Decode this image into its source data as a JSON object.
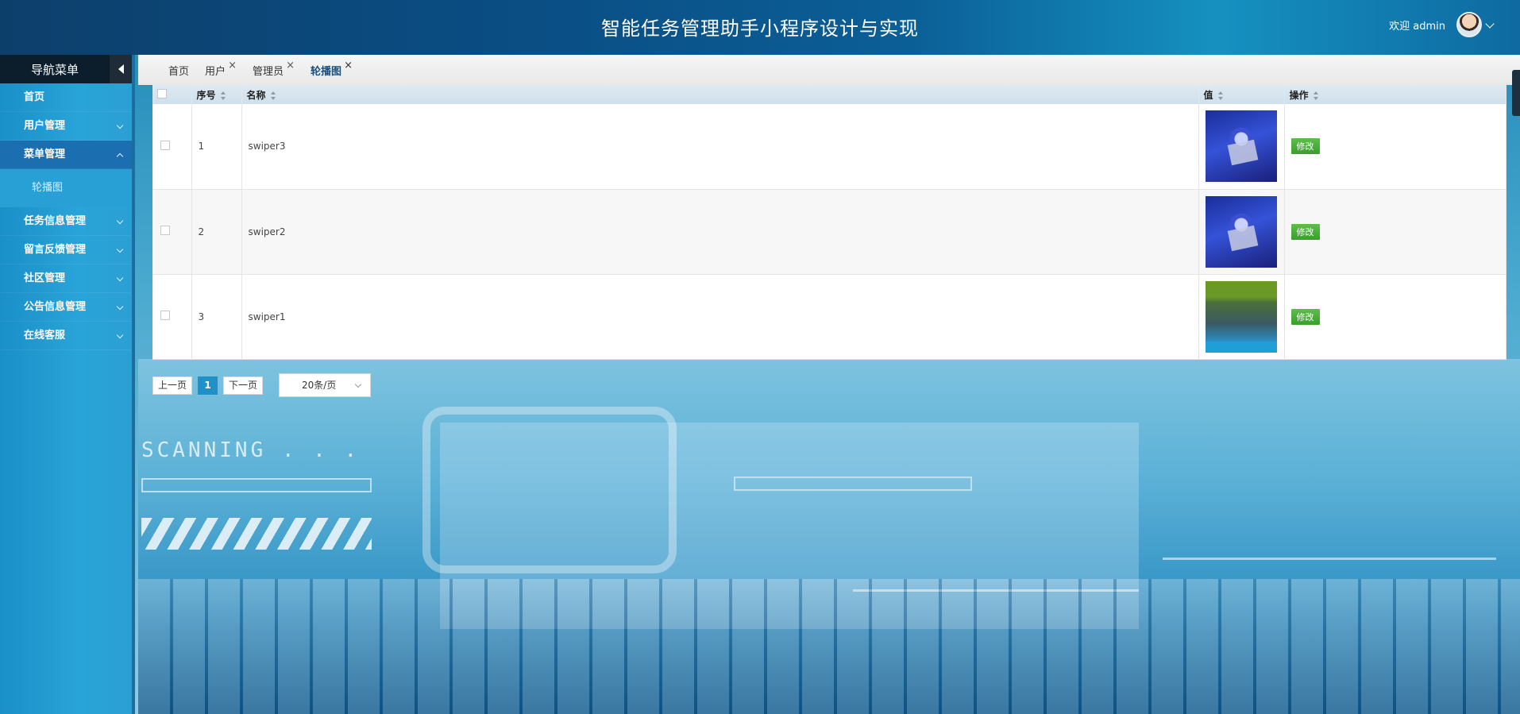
{
  "header": {
    "title": "智能任务管理助手小程序设计与实现",
    "welcome": "欢迎 admin"
  },
  "sidebar": {
    "title": "导航菜单",
    "items": [
      {
        "label": "首页",
        "expandable": false
      },
      {
        "label": "用户管理",
        "expandable": true
      },
      {
        "label": "菜单管理",
        "expandable": true,
        "open": true,
        "children": [
          "轮播图"
        ]
      },
      {
        "label": "任务信息管理",
        "expandable": true
      },
      {
        "label": "留言反馈管理",
        "expandable": true
      },
      {
        "label": "社区管理",
        "expandable": true
      },
      {
        "label": "公告信息管理",
        "expandable": true
      },
      {
        "label": "在线客服",
        "expandable": true
      }
    ]
  },
  "tabs": [
    {
      "label": "首页",
      "closable": false,
      "active": false
    },
    {
      "label": "用户",
      "closable": true,
      "active": false
    },
    {
      "label": "管理员",
      "closable": true,
      "active": false
    },
    {
      "label": "轮播图",
      "closable": true,
      "active": true
    }
  ],
  "tab_close_glyph": "×",
  "table": {
    "columns": [
      "序号",
      "名称",
      "值",
      "操作"
    ],
    "rows": [
      {
        "index": "1",
        "name": "swiper3",
        "image": "blue",
        "action": "修改"
      },
      {
        "index": "2",
        "name": "swiper2",
        "image": "blue",
        "action": "修改"
      },
      {
        "index": "3",
        "name": "swiper1",
        "image": "green",
        "action": "修改"
      }
    ]
  },
  "pagination": {
    "prev": "上一页",
    "current": "1",
    "next": "下一页",
    "page_size": "20条/页"
  },
  "background": {
    "text": "SCANNING . . ."
  },
  "colors": {
    "header": "#0b5f97",
    "sidebar": "#29a4d8",
    "active_menu": "#1b6fb0",
    "edit_button": "#4caf3a",
    "current_page": "#2290c8"
  }
}
